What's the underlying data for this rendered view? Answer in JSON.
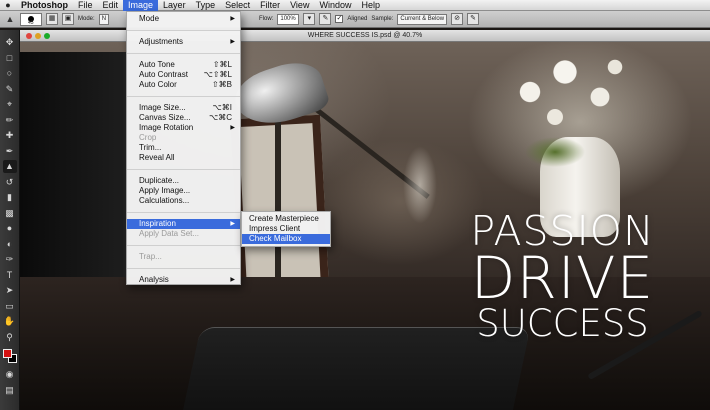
{
  "menubar": {
    "app": "Photoshop",
    "items": [
      "File",
      "Edit",
      "Image",
      "Layer",
      "Type",
      "Select",
      "Filter",
      "View",
      "Window",
      "Help"
    ],
    "active": "Image"
  },
  "options_bar": {
    "brush_size": "45",
    "mode_label": "Mode:",
    "mode_value": "N",
    "flow_label": "Flow:",
    "flow_value": "100%",
    "aligned_label": "Aligned",
    "sample_label": "Sample:",
    "sample_value": "Current & Below"
  },
  "document": {
    "title": "WHERE SUCCESS IS.psd @ 40.7%"
  },
  "image_menu": {
    "mode": "Mode",
    "adjustments": "Adjustments",
    "auto_tone": "Auto Tone",
    "auto_tone_sc": "⇧⌘L",
    "auto_contrast": "Auto Contrast",
    "auto_contrast_sc": "⌥⇧⌘L",
    "auto_color": "Auto Color",
    "auto_color_sc": "⇧⌘B",
    "image_size": "Image Size...",
    "image_size_sc": "⌥⌘I",
    "canvas_size": "Canvas Size...",
    "canvas_size_sc": "⌥⌘C",
    "image_rotation": "Image Rotation",
    "crop": "Crop",
    "trim": "Trim...",
    "reveal_all": "Reveal All",
    "duplicate": "Duplicate...",
    "apply_image": "Apply Image...",
    "calculations": "Calculations...",
    "inspiration": "Inspiration",
    "apply_data_set": "Apply Data Set...",
    "trap": "Trap...",
    "analysis": "Analysis"
  },
  "inspiration_submenu": {
    "items": [
      "Create Masterpiece",
      "Impress Client",
      "Check Mailbox"
    ],
    "highlighted": "Check Mailbox"
  },
  "slogan": {
    "line1": "PASSION",
    "line2": "DRIVE",
    "line3": "SUCCESS"
  },
  "colors": {
    "foreground": "#d41010",
    "background": "#000000",
    "menu_highlight": "#3a6bdc"
  }
}
